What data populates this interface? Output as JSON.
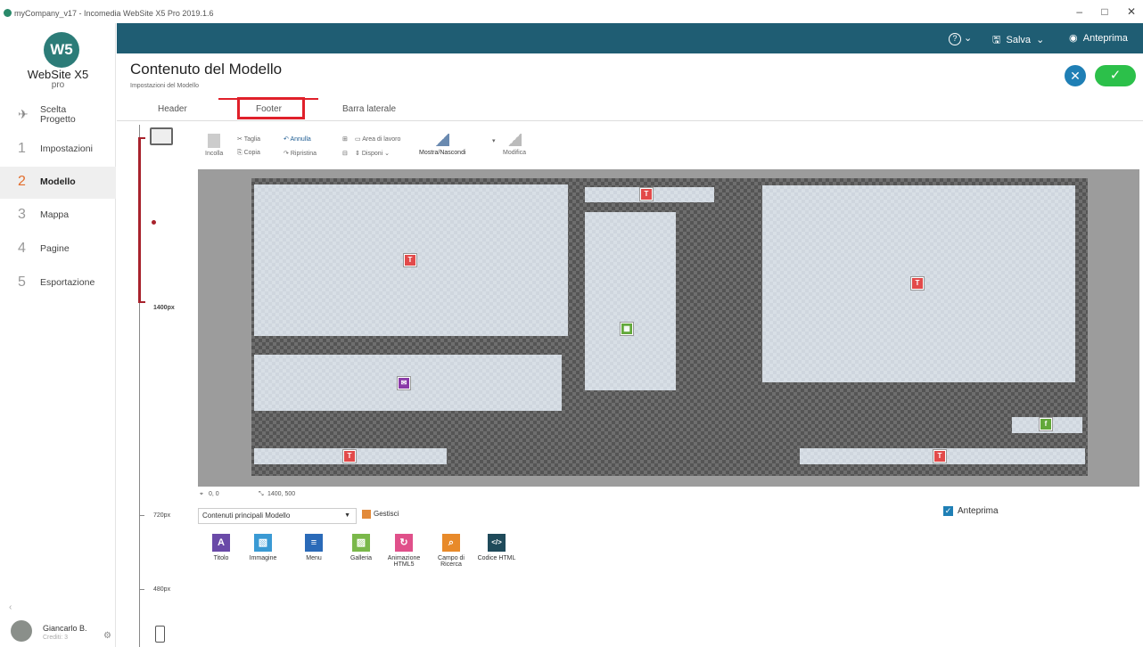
{
  "window": {
    "title": "myCompany_v17 - Incomedia WebSite X5 Pro 2019.1.6",
    "controls": [
      "–",
      "□",
      "✕"
    ]
  },
  "sidebar": {
    "logo": "W5",
    "brand": "WebSite X5",
    "edition": "pro",
    "items": [
      {
        "num": "",
        "label": "Scelta Progetto"
      },
      {
        "num": "1",
        "label": "Impostazioni"
      },
      {
        "num": "2",
        "label": "Modello"
      },
      {
        "num": "3",
        "label": "Mappa"
      },
      {
        "num": "4",
        "label": "Pagine"
      },
      {
        "num": "5",
        "label": "Esportazione"
      }
    ],
    "active_index": 2,
    "user": {
      "name": "Giancarlo B.",
      "sub": "Crediti: 3"
    }
  },
  "topbar": {
    "help": "?",
    "save": "Salva",
    "preview": "Anteprima"
  },
  "header": {
    "title": "Contenuto del Modello",
    "subtitle": "Impostazioni del Modello"
  },
  "tabs": [
    "Header",
    "Footer",
    "Barra laterale"
  ],
  "selected_tab": "Footer",
  "ruler": {
    "labels": [
      "1400px",
      "720px",
      "480px"
    ]
  },
  "toolbar": {
    "paste": "Incolla",
    "cut": "Taglia",
    "copy": "Copia",
    "undo": "Annulla",
    "redo": "Ripristina",
    "workarea": "Area di lavoro",
    "arrange": "Disponi",
    "showhide": "Mostra/Nascondi",
    "edit": "Modifica"
  },
  "coords": {
    "pos": "0, 0",
    "size": "1400, 500"
  },
  "objects_panel": {
    "select_value": "Contenuti principali Modello",
    "manage": "Gestisci",
    "preview_label": "Anteprima",
    "objects": [
      {
        "label": "Titolo",
        "icon": "A",
        "color": "#6a4aa8"
      },
      {
        "label": "Immagine",
        "icon": "▧",
        "color": "#3a9ad4"
      },
      {
        "label": "Menu",
        "icon": "≡",
        "color": "#2a6ab8"
      },
      {
        "label": "Galleria",
        "icon": "▨",
        "color": "#7ab84a"
      },
      {
        "label": "Animazione HTML5",
        "icon": "↻",
        "color": "#e0508a"
      },
      {
        "label": "Campo di Ricerca",
        "icon": "⌕",
        "color": "#e88a2a"
      },
      {
        "label": "Codice HTML",
        "icon": "</>",
        "color": "#1f4a5a"
      }
    ]
  }
}
